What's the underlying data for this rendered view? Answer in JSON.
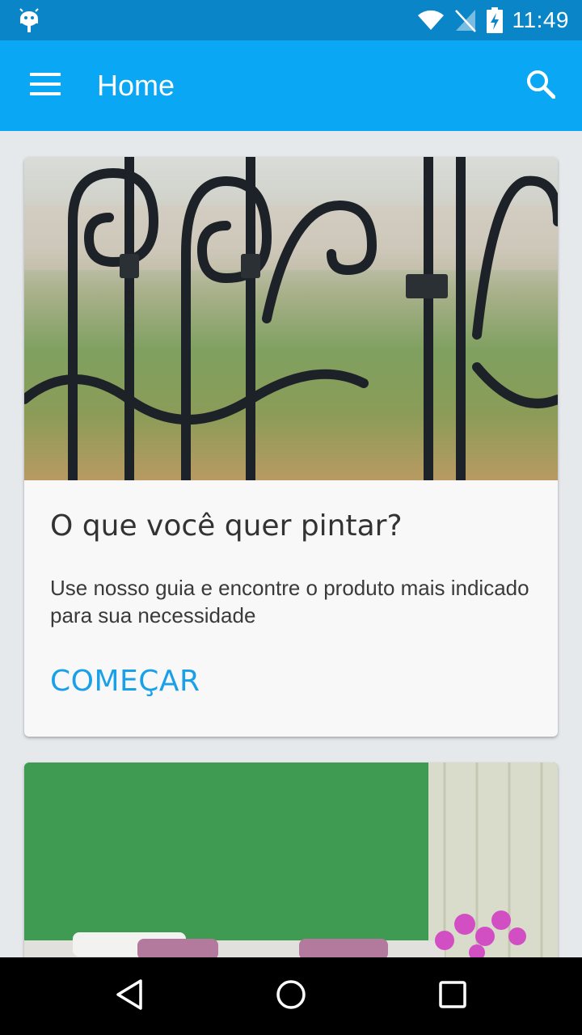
{
  "status_bar": {
    "time": "11:49",
    "icons": [
      "android-icon",
      "wifi-icon",
      "no-signal-icon",
      "battery-charging-icon"
    ]
  },
  "app_bar": {
    "title": "Home",
    "menu_icon": "menu-icon",
    "search_icon": "search-icon"
  },
  "cards": [
    {
      "image": "wrought-iron-gate-photo",
      "title": "O que você quer pintar?",
      "text": "Use nosso guia e encontre o produto mais indicado para sua necessidade",
      "action_label": "COMEÇAR"
    },
    {
      "image": "green-wall-room-photo"
    }
  ],
  "nav_bar": {
    "icons": [
      "back-icon",
      "home-icon",
      "recents-icon"
    ]
  },
  "colors": {
    "status_bar": "#0a86c8",
    "app_bar": "#0aa7f5",
    "accent": "#1aa0e8",
    "background": "#e6e9ec"
  }
}
